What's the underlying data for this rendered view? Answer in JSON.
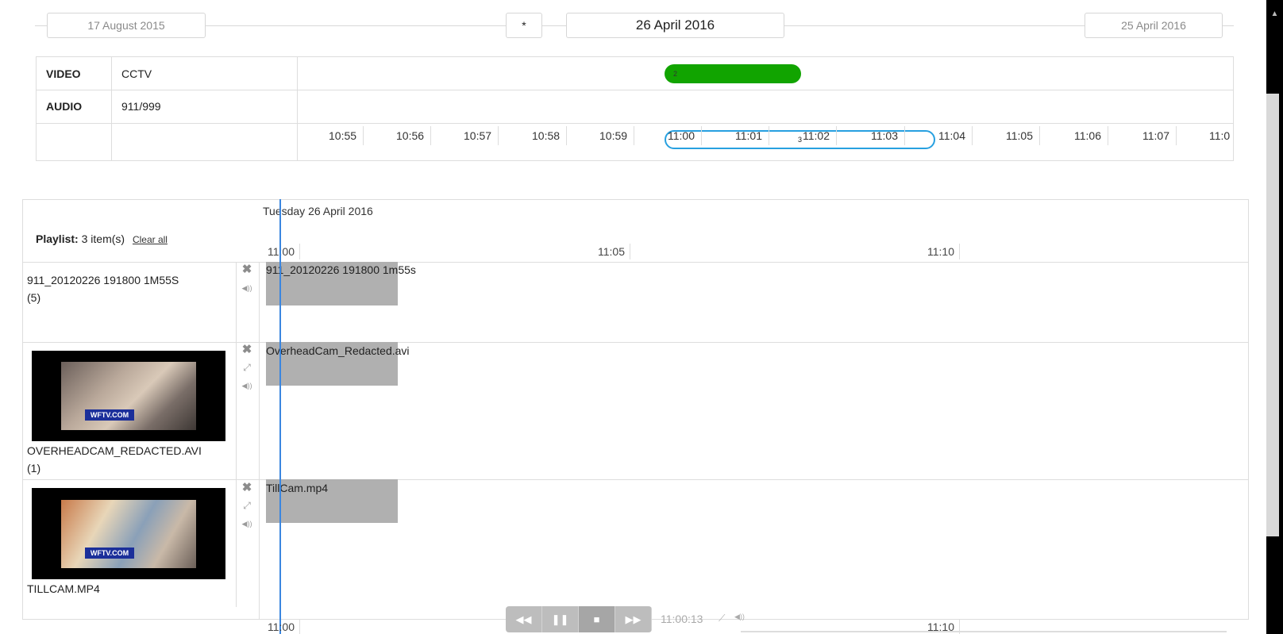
{
  "date_nav": {
    "left_date": "17 August 2015",
    "star": "*",
    "center_date": "26 April 2016",
    "right_date": "25 April 2016"
  },
  "timeline": {
    "rows": [
      {
        "type": "VIDEO",
        "source": "CCTV",
        "bar_label": "2",
        "bar_color": "#11a400"
      },
      {
        "type": "AUDIO",
        "source": "911/999",
        "bar_label": "3",
        "bar_color": "#27a0e0"
      }
    ],
    "ticks": [
      "10:55",
      "10:56",
      "10:57",
      "10:58",
      "10:59",
      "11:00",
      "11:01",
      "11:02",
      "11:03",
      "11:04",
      "11:05",
      "11:06",
      "11:07",
      "11:0"
    ]
  },
  "playlist": {
    "label": "Playlist:",
    "count": "3",
    "count_suffix": "item(s)",
    "clear_all": "Clear all",
    "day": "Tuesday 26 April 2016",
    "ruler_ticks": [
      "11:00",
      "11:05",
      "11:10"
    ],
    "bottom_ruler_ticks": [
      "11:00",
      "11:10"
    ],
    "tracks": [
      {
        "name": "911_20120226 191800 1M55S",
        "count": "(5)",
        "clip": "911_20120226 191800 1m55s",
        "has_thumb": false
      },
      {
        "name": "OVERHEADCAM_REDACTED.AVI",
        "count": "(1)",
        "clip": "OverheadCam_Redacted.avi",
        "has_thumb": true,
        "thumb_logo": "WFTV.COM"
      },
      {
        "name": "TILLCAM.MP4",
        "count": "",
        "clip": "TillCam.mp4",
        "has_thumb": true,
        "thumb_logo": "WFTV.COM"
      }
    ]
  },
  "transport": {
    "time": "11:00:13",
    "rewind": "rewind-icon",
    "pause": "pause-icon",
    "stop": "stop-icon",
    "forward": "fast-forward-icon"
  },
  "icons": {
    "remove": "close-icon",
    "expand": "expand-icon",
    "volume": "volume-icon"
  },
  "colors": {
    "accent": "#3a86e0",
    "video_bar": "#11a400",
    "audio_bar": "#27a0e0"
  }
}
